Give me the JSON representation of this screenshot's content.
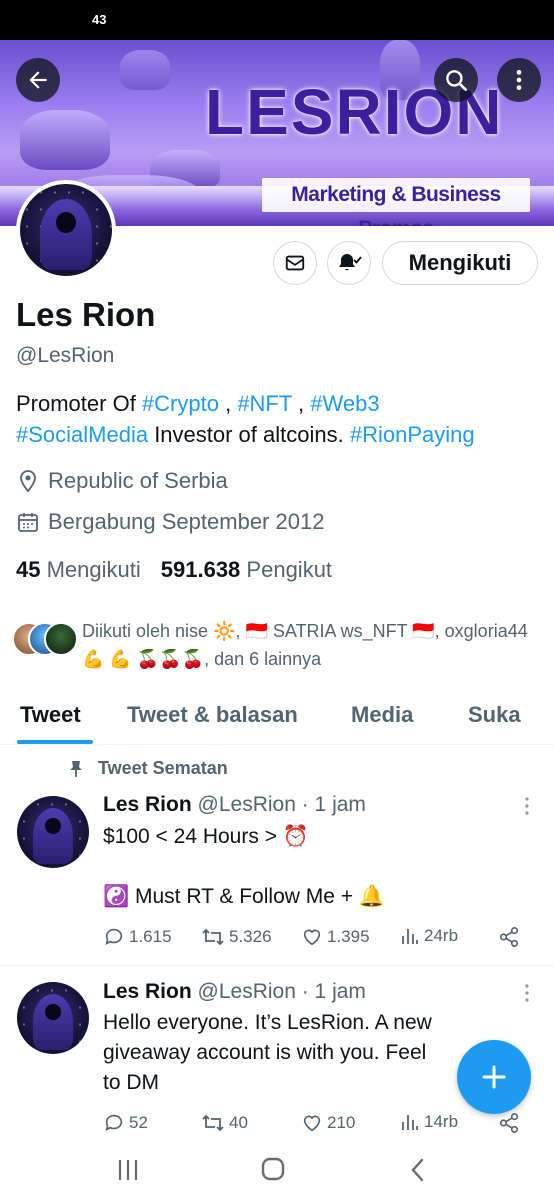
{
  "status_bar": {
    "time": "43"
  },
  "banner": {
    "title": "LESRION",
    "subtitle": "Marketing & Business Promos"
  },
  "profile_actions": {
    "follow_label": "Mengikuti"
  },
  "profile": {
    "name": "Les Rion",
    "handle": "@LesRion",
    "bio": {
      "t1": "Promoter Of ",
      "h1": "#Crypto",
      "t2": " , ",
      "h2": "#NFT",
      "t3": " , ",
      "h3": "#Web3",
      "h4": "#SocialMedia",
      "t4": " Investor of altcoins. ",
      "h5": "#RionPaying"
    },
    "location": "Republic of Serbia",
    "joined": "Bergabung September 2012",
    "following_count": "45",
    "following_label": "Mengikuti",
    "followers_count": "591.638",
    "followers_label": "Pengikut",
    "followed_by": "Diikuti oleh nise 🔆, 🇮🇩 SATRIA ws_NFT 🇮🇩, oxgloria44💪 💪 🍒🍒🍒, dan 6 lainnya"
  },
  "tabs": [
    {
      "label": "Tweet"
    },
    {
      "label": "Tweet & balasan"
    },
    {
      "label": "Media"
    },
    {
      "label": "Suka"
    }
  ],
  "pinned_label": "Tweet Sematan",
  "tweets": [
    {
      "name": "Les Rion",
      "meta": "@LesRion · 1 jam",
      "line1": "$100 < 24 Hours > ⏰",
      "line2": "☯️ Must RT & Follow Me + 🔔",
      "replies": "1.615",
      "retweets": "5.326",
      "likes": "1.395",
      "views": "24rb"
    },
    {
      "name": "Les Rion",
      "meta": "@LesRion · 1 jam",
      "line1": "Hello everyone.  It’s  LesRion.  A new",
      "line2": "giveaway account is with you.  Feel",
      "line3": "to DM",
      "replies": "52",
      "retweets": "40",
      "likes": "210",
      "views": "14rb"
    }
  ],
  "colors": {
    "accent": "#1d9bf0",
    "text": "#0f1419",
    "muted": "#536471"
  }
}
